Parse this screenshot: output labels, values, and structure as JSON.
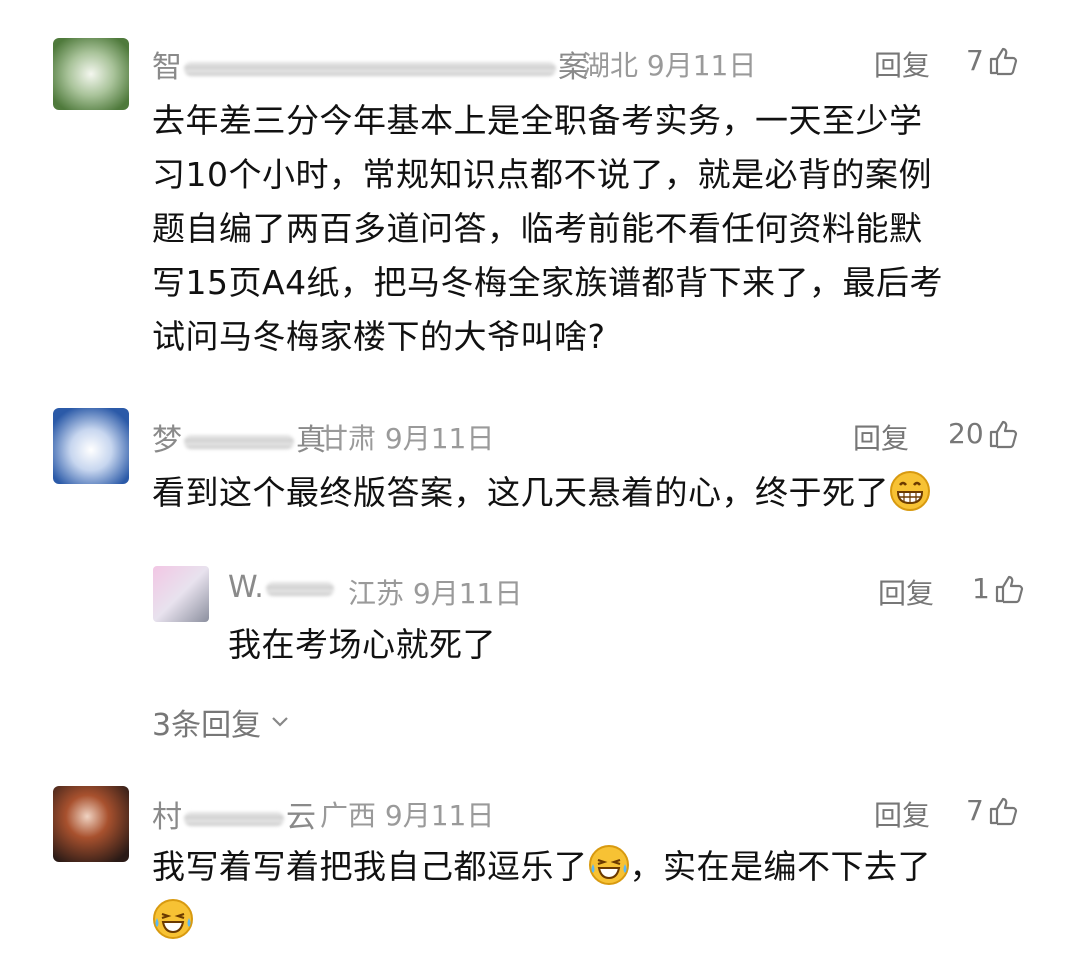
{
  "comments": [
    {
      "name_start": "智",
      "name_end": "案",
      "location": "湖北",
      "date": "9月11日",
      "reply_label": "回复",
      "likes": "7",
      "lines": [
        "去年差三分今年基本上是全职备考实务，一天至少学",
        "习10个小时，常规知识点都不说了，就是必背的案例",
        "题自编了两百多道问答，临考前能不看任何资料能默",
        "写15页A4纸，把马冬梅全家族谱都背下来了，最后考",
        "试问马冬梅家楼下的大爷叫啥?"
      ]
    },
    {
      "name_start": "梦",
      "name_end": "真",
      "location": "甘肃",
      "date": "9月11日",
      "reply_label": "回复",
      "likes": "20",
      "text": "看到这个最终版答案，这几天悬着的心，终于死了",
      "emoji": "grinning-face-emoji",
      "replies": [
        {
          "name_start": "W.",
          "location": "江苏",
          "date": "9月11日",
          "reply_label": "回复",
          "likes": "1",
          "text": "我在考场心就死了"
        }
      ],
      "more_replies": "3条回复"
    },
    {
      "name_start": "村",
      "name_end": "云",
      "location": "广西",
      "date": "9月11日",
      "reply_label": "回复",
      "likes": "7",
      "text": "我写着写着把我自己都逗乐了",
      "text_after": "，实在是编不下去了",
      "emojis": [
        "tears-of-joy-emoji",
        "crying-laughing-emoji"
      ]
    }
  ],
  "colors": {
    "text": "#111111",
    "meta": "#9a9a9a",
    "action": "#777777"
  }
}
